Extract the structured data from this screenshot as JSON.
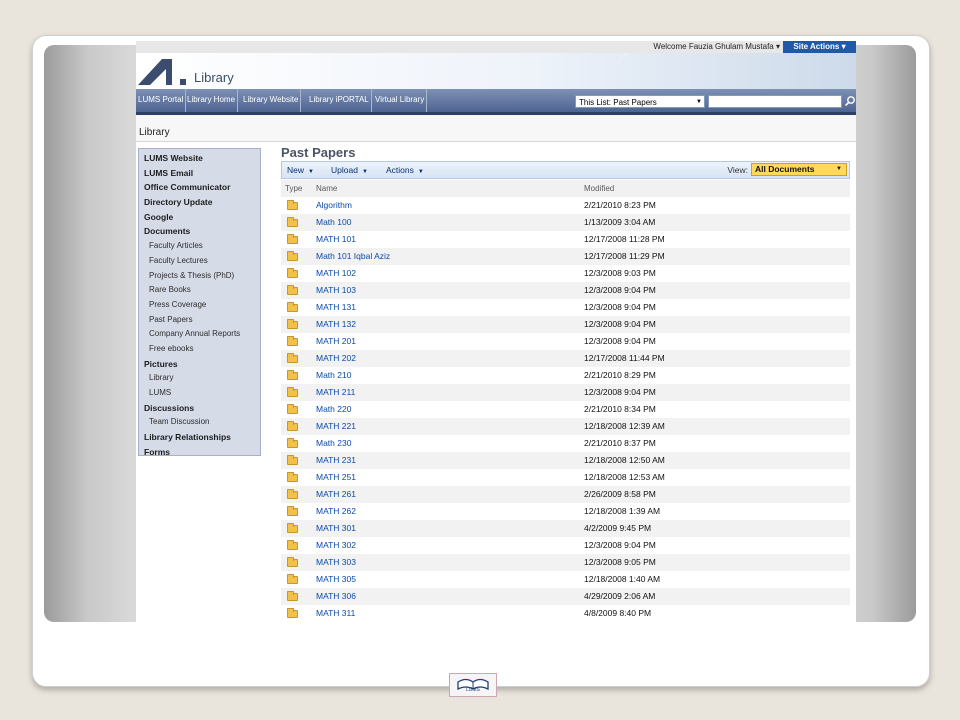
{
  "topbar": {
    "welcome": "Welcome Fauzia Ghulam Mustafa ▾",
    "site_actions": "Site Actions ▾"
  },
  "header": {
    "site_title": "Library"
  },
  "nav": {
    "tabs": [
      "LUMS Portal",
      "Library Home",
      "Library Website",
      "Library iPORTAL",
      "Virtual Library"
    ],
    "search_scope": "This List: Past Papers",
    "search_value": ""
  },
  "breadcrumb": "Library",
  "quick_launch": [
    {
      "label": "LUMS Website",
      "type": "h"
    },
    {
      "label": "LUMS Email",
      "type": "h"
    },
    {
      "label": "Office Communicator",
      "type": "h"
    },
    {
      "label": "Directory Update",
      "type": "h"
    },
    {
      "label": "Google",
      "type": "h"
    },
    {
      "label": "Documents",
      "type": "h"
    },
    {
      "label": "Faculty Articles",
      "type": "s"
    },
    {
      "label": "Faculty Lectures",
      "type": "s"
    },
    {
      "label": "Projects & Thesis (PhD)",
      "type": "s"
    },
    {
      "label": "Rare Books",
      "type": "s"
    },
    {
      "label": "Press Coverage",
      "type": "s"
    },
    {
      "label": "Past Papers",
      "type": "s"
    },
    {
      "label": "Company Annual Reports",
      "type": "s"
    },
    {
      "label": "Free ebooks",
      "type": "s"
    },
    {
      "label": "Pictures",
      "type": "h"
    },
    {
      "label": "Library",
      "type": "s"
    },
    {
      "label": "LUMS",
      "type": "s"
    },
    {
      "label": "Discussions",
      "type": "h"
    },
    {
      "label": "Team Discussion",
      "type": "s"
    },
    {
      "label": "Library Relationships",
      "type": "h"
    },
    {
      "label": "Forms",
      "type": "h"
    }
  ],
  "main": {
    "title": "Past Papers",
    "toolbar": {
      "new": "New",
      "upload": "Upload",
      "actions": "Actions",
      "view_label": "View:",
      "view_value": "All Documents"
    },
    "columns": {
      "type": "Type",
      "name": "Name",
      "modified": "Modified"
    },
    "rows": [
      {
        "name": "Algorithm",
        "modified": "2/21/2010 8:23 PM"
      },
      {
        "name": "Math 100",
        "modified": "1/13/2009 3:04 AM"
      },
      {
        "name": "MATH 101",
        "modified": "12/17/2008 11:28 PM"
      },
      {
        "name": "Math 101 Iqbal Aziz",
        "modified": "12/17/2008 11:29 PM"
      },
      {
        "name": "MATH 102",
        "modified": "12/3/2008 9:03 PM"
      },
      {
        "name": "MATH 103",
        "modified": "12/3/2008 9:04 PM"
      },
      {
        "name": "MATH 131",
        "modified": "12/3/2008 9:04 PM"
      },
      {
        "name": "MATH 132",
        "modified": "12/3/2008 9:04 PM"
      },
      {
        "name": "MATH 201",
        "modified": "12/3/2008 9:04 PM"
      },
      {
        "name": "MATH 202",
        "modified": "12/17/2008 11:44 PM"
      },
      {
        "name": "Math 210",
        "modified": "2/21/2010 8:29 PM"
      },
      {
        "name": "MATH 211",
        "modified": "12/3/2008 9:04 PM"
      },
      {
        "name": "Math 220",
        "modified": "2/21/2010 8:34 PM"
      },
      {
        "name": "MATH 221",
        "modified": "12/18/2008 12:39 AM"
      },
      {
        "name": "Math 230",
        "modified": "2/21/2010 8:37 PM"
      },
      {
        "name": "MATH 231",
        "modified": "12/18/2008 12:50 AM"
      },
      {
        "name": "MATH 251",
        "modified": "12/18/2008 12:53 AM"
      },
      {
        "name": "MATH 261",
        "modified": "2/26/2009 8:58 PM"
      },
      {
        "name": "MATH 262",
        "modified": "12/18/2008 1:39 AM"
      },
      {
        "name": "MATH 301",
        "modified": "4/2/2009 9:45 PM"
      },
      {
        "name": "MATH 302",
        "modified": "12/3/2008 9:04 PM"
      },
      {
        "name": "MATH 303",
        "modified": "12/3/2008 9:05 PM"
      },
      {
        "name": "MATH 305",
        "modified": "12/18/2008 1:40 AM"
      },
      {
        "name": "MATH 306",
        "modified": "4/29/2009 2:06 AM"
      },
      {
        "name": "MATH 311",
        "modified": "4/8/2009 8:40 PM"
      }
    ]
  },
  "footer_logo_text": "LUMS",
  "colors": {
    "nav": "#4e6491",
    "site_actions": "#1e5aa8",
    "link": "#0a4aa8",
    "view_select": "#ffd85c",
    "folder": "#f2c14a"
  }
}
